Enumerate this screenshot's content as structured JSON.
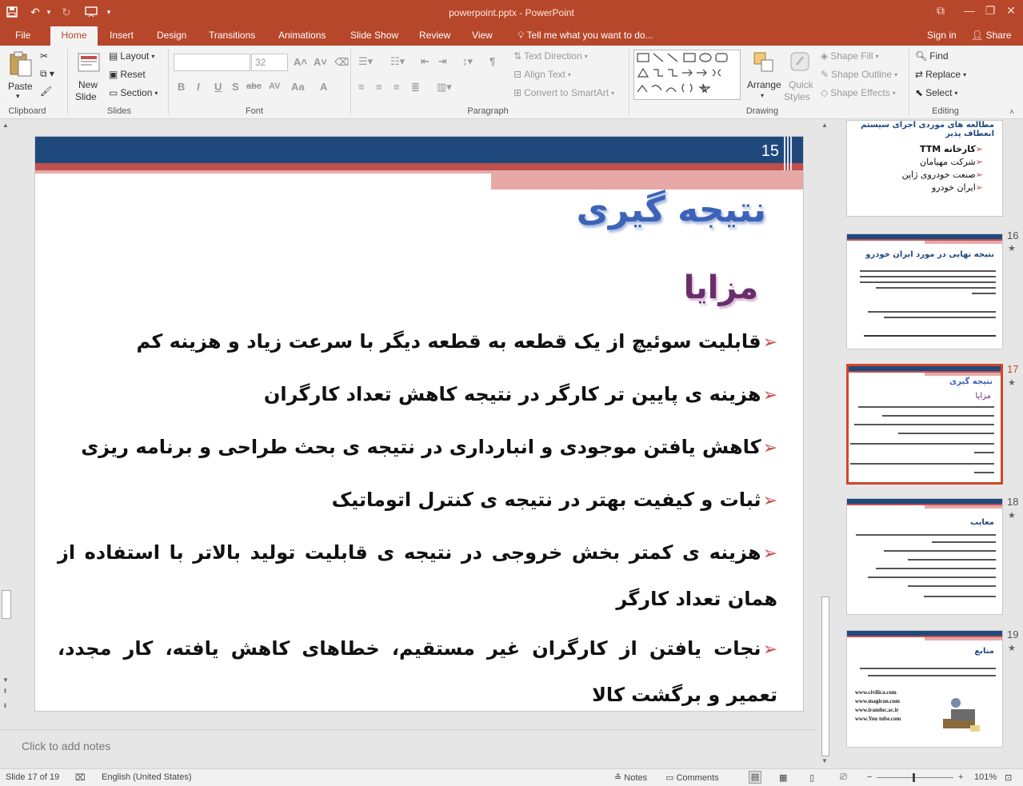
{
  "window": {
    "title": "powerpoint.pptx - PowerPoint",
    "controls": {
      "restore": "⧉",
      "minimize": "—",
      "maximize": "❐",
      "close": "✕"
    }
  },
  "qat": {
    "save_icon": "save-icon",
    "undo_icon": "undo-icon",
    "redo_icon": "redo-icon",
    "present_icon": "present-icon",
    "more_icon": "more-icon"
  },
  "tabs": [
    "File",
    "Home",
    "Insert",
    "Design",
    "Transitions",
    "Animations",
    "Slide Show",
    "Review",
    "View"
  ],
  "tell_me": "Tell me what you want to do...",
  "sign_in": "Sign in",
  "share": "Share",
  "ribbon": {
    "clipboard": {
      "label": "Clipboard",
      "paste": "Paste"
    },
    "slides": {
      "label": "Slides",
      "new_slide_1": "New",
      "new_slide_2": "Slide",
      "layout": "Layout",
      "reset": "Reset",
      "section": "Section"
    },
    "font": {
      "label": "Font",
      "name": "",
      "size": "32",
      "bold": "B",
      "italic": "I",
      "underline": "U",
      "shadow": "S",
      "strike": "abc",
      "spacing": "AV",
      "case": "Aa"
    },
    "paragraph": {
      "label": "Paragraph",
      "text_direction": "Text Direction",
      "align_text": "Align Text",
      "smartart": "Convert to SmartArt"
    },
    "drawing": {
      "label": "Drawing",
      "arrange": "Arrange",
      "quick_styles_1": "Quick",
      "quick_styles_2": "Styles",
      "shape_fill": "Shape Fill",
      "shape_outline": "Shape Outline",
      "shape_effects": "Shape Effects"
    },
    "editing": {
      "label": "Editing",
      "find": "Find",
      "replace": "Replace",
      "select": "Select"
    }
  },
  "slide": {
    "number": "15",
    "title": "نتیجه گیری",
    "subtitle": "مزایا",
    "bullets": [
      "قابلیت سوئیچ از یک قطعه به قطعه دیگر با سرعت زیاد و هزینه کم",
      "هزینه ی پایین تر کارگر در نتیجه کاهش تعداد کارگران",
      "کاهش یافتن موجودی و انبارداری در نتیجه ی بحث طراحی و برنامه ریزی",
      "ثبات و کیفیت بهتر در نتیجه ی کنترل اتوماتیک",
      "هزینه ی کمتر بخش خروجی در نتیجه ی قابلیت تولید بالاتر با استفاده از همان تعداد کارگر",
      "نجات یافتن از کارگران غیر مستقیم، خطاهای کاهش یافته، کار مجدد، تعمیر و برگشت کالا"
    ]
  },
  "notes_placeholder": "Click to add notes",
  "thumbnails": [
    {
      "num": "",
      "title": "مطالعه های موردی اجرای سیستم انعطاف پذیر",
      "items": [
        "کارخانه TTM",
        "شرکت مهیامان",
        "صنعت خودروی ژاپن",
        "ایران خودرو"
      ]
    },
    {
      "num": "16",
      "star": "★",
      "title": "نتیجه نهایی در مورد ایران خودرو"
    },
    {
      "num": "17",
      "star": "★",
      "title": "نتیجه گیری",
      "subtitle": "مزایا"
    },
    {
      "num": "18",
      "star": "★",
      "title": "معایب"
    },
    {
      "num": "19",
      "star": "★",
      "title": "منابع",
      "links": [
        "www.civilica.com",
        "www.magiran.com",
        "www.irandoc.ac.ir",
        "www.You tube.com"
      ]
    }
  ],
  "status": {
    "slide_info": "Slide 17 of 19",
    "language": "English (United States)",
    "notes": "Notes",
    "comments": "Comments",
    "zoom": "101%"
  }
}
